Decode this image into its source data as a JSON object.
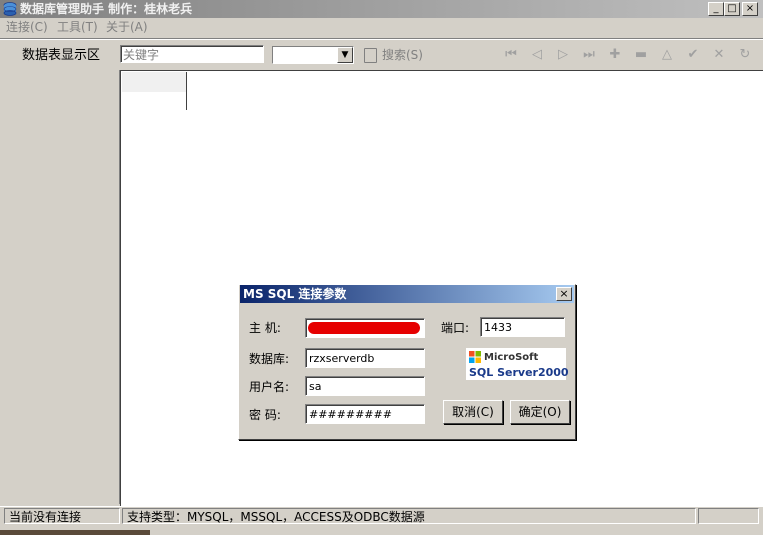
{
  "window": {
    "title": "数据库管理助手  制作：桂林老兵",
    "min_glyph": "_",
    "max_glyph": "□",
    "close_glyph": "×"
  },
  "menu": [
    {
      "label": "连接(C)"
    },
    {
      "label": "工具(T)"
    },
    {
      "label": "关于(A)"
    }
  ],
  "toolbar": {
    "table_area_label": "数据表显示区",
    "keyword_placeholder": "关键字",
    "combo_value": "",
    "search_label": "搜索(S)",
    "nav_icons": [
      {
        "name": "first-record-icon",
        "glyph": "⏮"
      },
      {
        "name": "prev-record-icon",
        "glyph": "◁"
      },
      {
        "name": "next-record-icon",
        "glyph": "▷"
      },
      {
        "name": "last-record-icon",
        "glyph": "⏭"
      },
      {
        "name": "insert-record-icon",
        "glyph": "✚"
      },
      {
        "name": "delete-record-icon",
        "glyph": "▬"
      },
      {
        "name": "edit-record-icon",
        "glyph": "△"
      },
      {
        "name": "post-record-icon",
        "glyph": "✔"
      },
      {
        "name": "cancel-record-icon",
        "glyph": "✕"
      },
      {
        "name": "refresh-record-icon",
        "glyph": "↻"
      }
    ]
  },
  "status": {
    "connection": "当前没有连接",
    "supported": "支持类型：MYSQL，MSSQL，ACCESS及ODBC数据源"
  },
  "dialog": {
    "title": "MS SQL 连接参数",
    "close_glyph": "×",
    "host_label": "主  机:",
    "host_value": "",
    "port_label": "端口:",
    "port_value": "1433",
    "database_label": "数据库:",
    "database_value": "rzxserverdb",
    "user_label": "用户名:",
    "user_value": "sa",
    "password_label": "密  码:",
    "password_value": "#########",
    "cancel_label": "取消(C)",
    "ok_label": "确定(O)",
    "logo_top": "MicroSoft",
    "logo_bottom": "SQL Server2000"
  },
  "colors": {
    "title_inactive": "#808080",
    "dialog_title": "#0a246a",
    "redaction": "#e60000"
  }
}
